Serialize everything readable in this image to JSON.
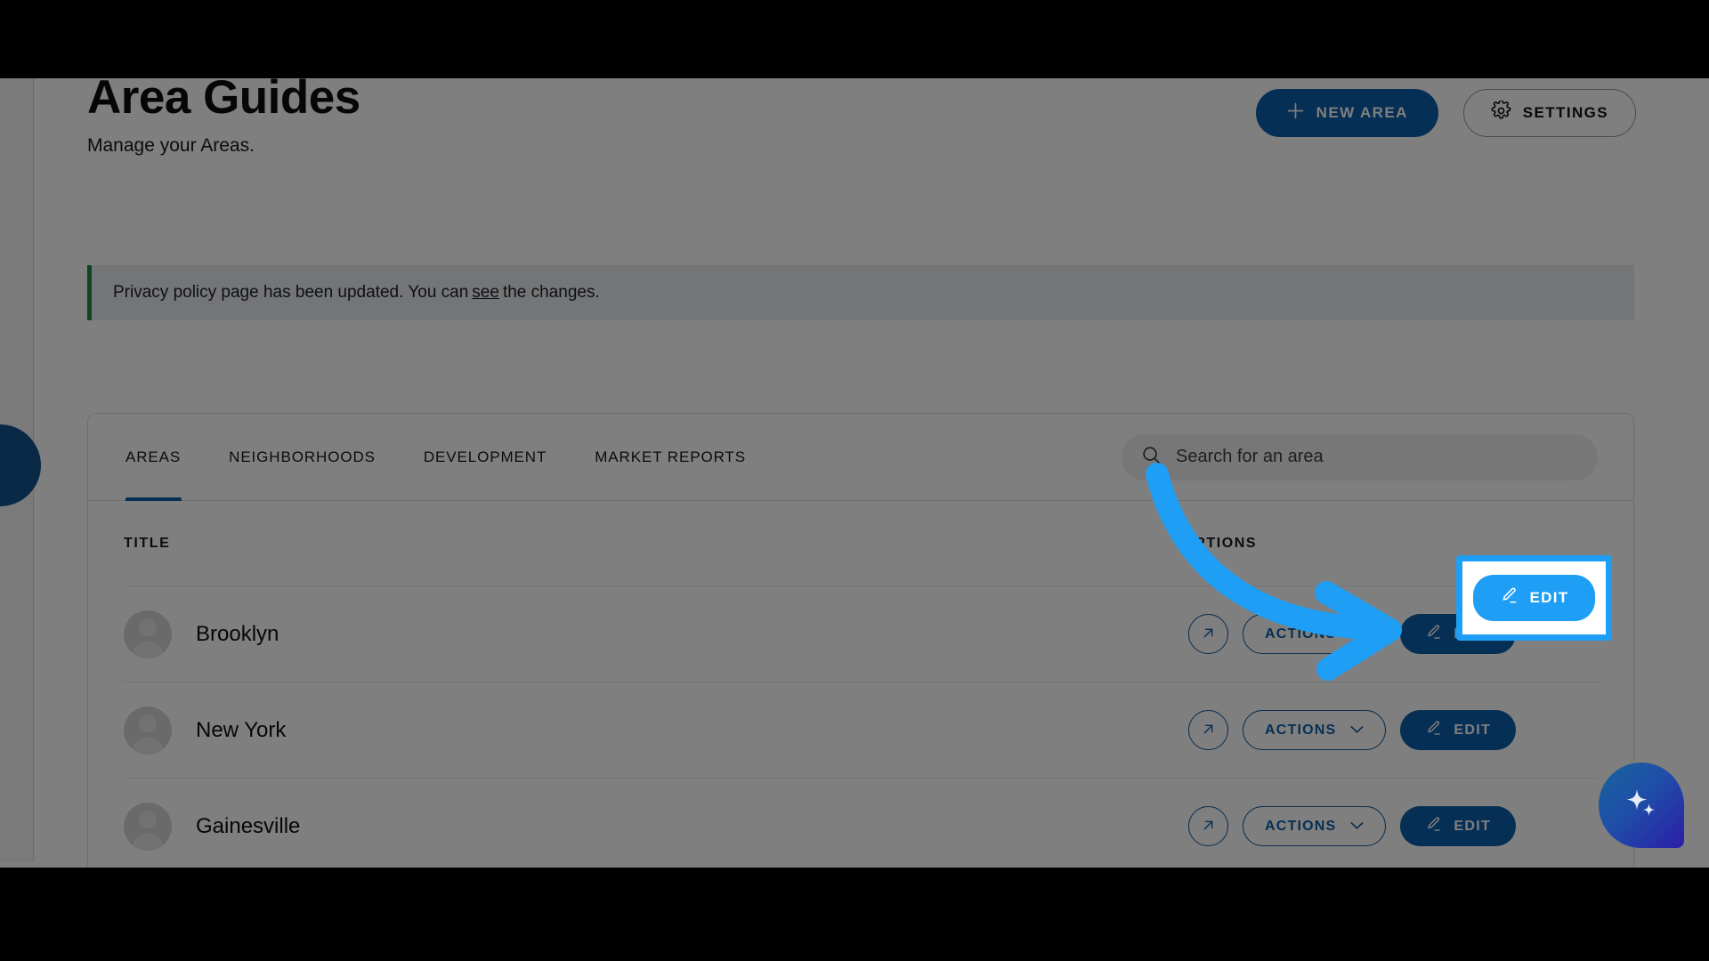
{
  "header": {
    "title": "Area Guides",
    "subtitle": "Manage your Areas.",
    "new_area_label": "NEW AREA",
    "settings_label": "SETTINGS"
  },
  "banner": {
    "text_before": "Privacy policy page has been updated. You can",
    "link": "see",
    "text_after": "the changes.",
    "accent_color": "#1f8a42"
  },
  "tabs": [
    {
      "label": "AREAS",
      "active": true
    },
    {
      "label": "NEIGHBORHOODS",
      "active": false
    },
    {
      "label": "DEVELOPMENT",
      "active": false
    },
    {
      "label": "MARKET REPORTS",
      "active": false
    }
  ],
  "search": {
    "placeholder": "Search for an area",
    "value": ""
  },
  "table": {
    "columns": [
      "TITLE",
      "OPTIONS"
    ],
    "rows": [
      {
        "title": "Brooklyn",
        "actions_label": "ACTIONS",
        "edit_label": "EDIT"
      },
      {
        "title": "New York",
        "actions_label": "ACTIONS",
        "edit_label": "EDIT"
      },
      {
        "title": "Gainesville",
        "actions_label": "ACTIONS",
        "edit_label": "EDIT"
      }
    ]
  },
  "annotation": {
    "highlight_edit_label": "EDIT",
    "arrow_color": "#1e9ef5",
    "highlight_color": "#1e9ef5"
  },
  "colors": {
    "primary": "#0b5ea8",
    "accent": "#1e9ef5",
    "text": "#16181c"
  }
}
